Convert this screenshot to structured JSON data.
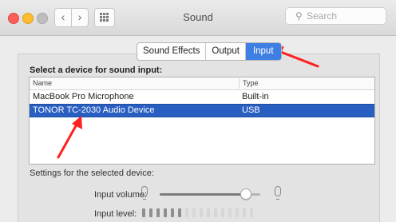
{
  "window": {
    "title": "Sound"
  },
  "search": {
    "placeholder": "Search"
  },
  "tabs": [
    {
      "label": "Sound Effects",
      "active": false
    },
    {
      "label": "Output",
      "active": false
    },
    {
      "label": "Input",
      "active": true
    }
  ],
  "device_section": {
    "title": "Select a device for sound input:",
    "columns": [
      "Name",
      "Type"
    ],
    "rows": [
      {
        "name": "MacBook Pro Microphone",
        "type": "Built-in",
        "selected": false
      },
      {
        "name": "TONOR TC-2030 Audio Device",
        "type": "USB",
        "selected": true
      }
    ]
  },
  "settings": {
    "label": "Settings for the selected device:",
    "input_volume_label": "Input volume:",
    "input_volume": 0.85,
    "input_level_label": "Input level:",
    "input_level_active": 6,
    "input_level_total": 16
  },
  "colors": {
    "accent": "#3f7fe3",
    "selection": "#2a5fc2",
    "annotation_arrow": "#ff2020"
  }
}
